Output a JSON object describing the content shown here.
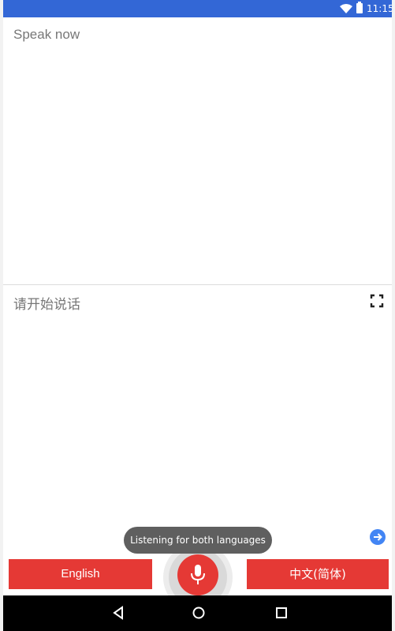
{
  "status_bar": {
    "time": "11:15",
    "wifi_icon": "wifi-icon",
    "battery_icon": "battery-icon"
  },
  "source_panel": {
    "prompt": "Speak now"
  },
  "target_panel": {
    "prompt": "请开始说话",
    "fullscreen_icon": "fullscreen-icon",
    "swap_icon": "arrow-right-circle-icon"
  },
  "toast": {
    "text": "Listening for both languages"
  },
  "languages": {
    "left": "English",
    "right": "中文(简体)"
  },
  "mic": {
    "icon": "microphone-icon"
  },
  "nav": {
    "back_icon": "back-triangle-icon",
    "home_icon": "home-circle-icon",
    "recents_icon": "recents-square-icon"
  },
  "colors": {
    "status_bar": "#3367d6",
    "accent_red": "#e53935",
    "toast": "#5f5f5f",
    "swap_blue": "#4285f4"
  }
}
